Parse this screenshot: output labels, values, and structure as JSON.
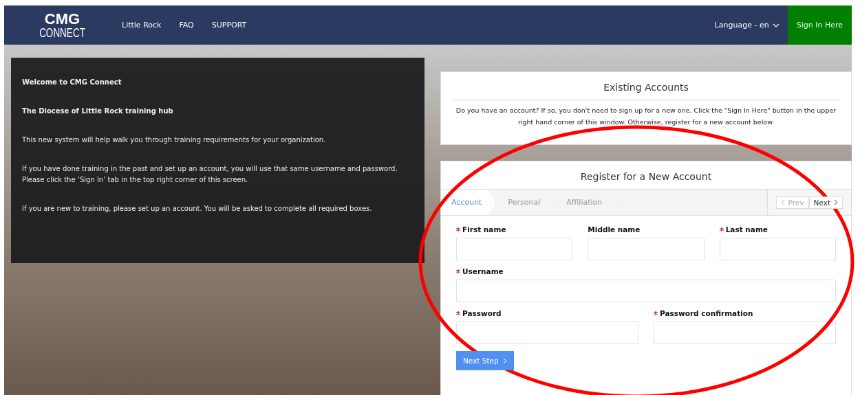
{
  "header": {
    "logo": {
      "line_1": "CMG",
      "line_2": "CONNECT"
    },
    "nav": [
      {
        "label": "Little Rock"
      },
      {
        "label": "FAQ"
      },
      {
        "label": "SUPPORT"
      }
    ],
    "language": "Language - en",
    "sign_in": "Sign In Here"
  },
  "welcome_panel": {
    "paragraphs": [
      {
        "text": "Welcome to CMG Connect",
        "bold": true
      },
      {
        "text": "The Diocese of Little Rock training hub",
        "bold": true
      },
      {
        "text": "This new system will help walk you through training requirements for your organization.",
        "bold": false
      },
      {
        "text": "If you have done training in the past and set up an account, you will use that same username and password.  Please click the ‘Sign In’ tab in the top right corner of this screen.",
        "bold": false
      },
      {
        "text": "If you are new to training, please set up an account.  You will be asked to complete all required boxes.",
        "bold": false
      }
    ]
  },
  "existing_accounts": {
    "title": "Existing Accounts",
    "text": "Do you have an account? If so, you don't need to sign up for a new one. Click the \"Sign In Here\" button in the upper right hand corner of this window. Otherwise, register for a new account below."
  },
  "register": {
    "title": "Register for a New Account",
    "steps": [
      {
        "label": "Account",
        "selected": true
      },
      {
        "label": "Personal",
        "selected": false
      },
      {
        "label": "Affiliation",
        "selected": false
      }
    ],
    "pager": [
      {
        "label": "Prev",
        "disabled": true
      },
      {
        "label": "Next",
        "disabled": false
      }
    ],
    "name_fields": [
      {
        "label": "First name",
        "required": true
      },
      {
        "label": "Middle name",
        "required": false
      },
      {
        "label": "Last name",
        "required": true
      }
    ],
    "username_field": {
      "label": "Username",
      "required": true
    },
    "password_fields": [
      {
        "label": "Password",
        "required": true
      },
      {
        "label": "Password confirmation",
        "required": true
      }
    ],
    "submit": "Next Step"
  }
}
